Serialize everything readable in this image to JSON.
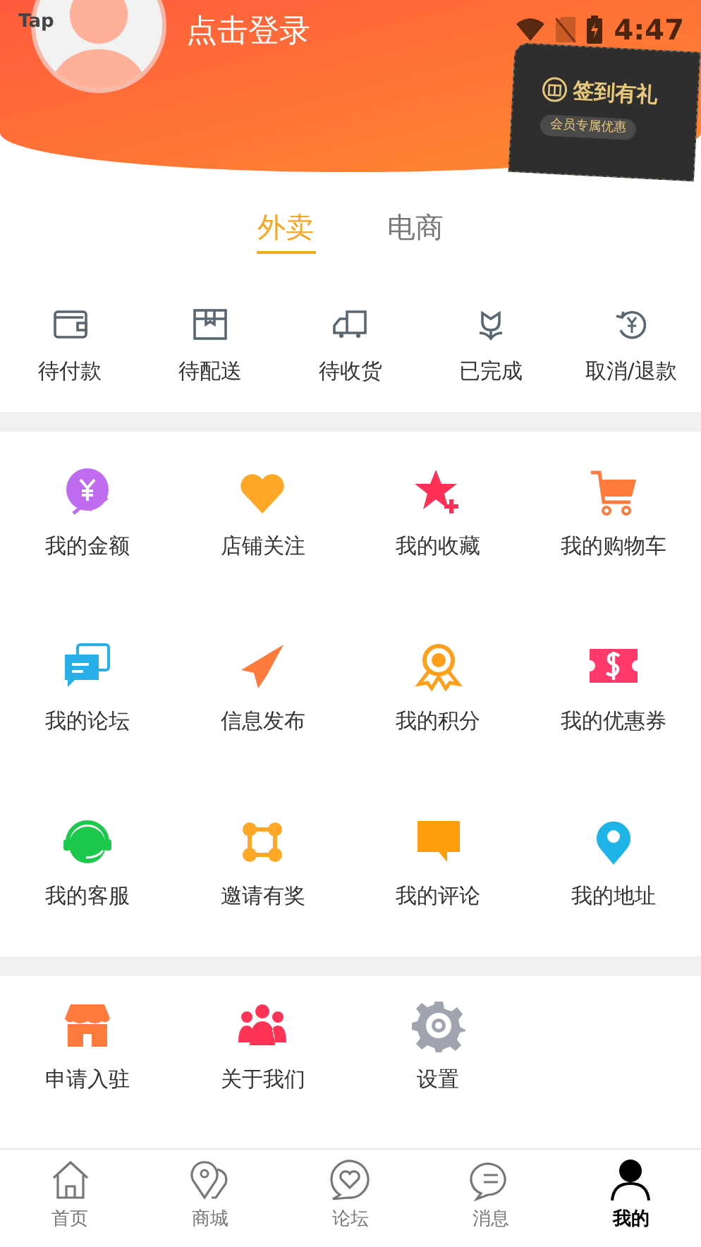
{
  "status_bar": {
    "app_label": "Tap",
    "time": "4:47"
  },
  "profile": {
    "login": "点击登录"
  },
  "checkin_card": {
    "title": "签到有礼",
    "subtitle": "会员专属优惠"
  },
  "tabs": [
    {
      "label": "外卖",
      "selected": true
    },
    {
      "label": "电商",
      "selected": false
    }
  ],
  "orders": [
    {
      "label": "待付款"
    },
    {
      "label": "待配送"
    },
    {
      "label": "待收货"
    },
    {
      "label": "已完成"
    },
    {
      "label": "取消/退款"
    }
  ],
  "features": [
    {
      "label": "我的金额"
    },
    {
      "label": "店铺关注"
    },
    {
      "label": "我的收藏"
    },
    {
      "label": "我的购物车"
    },
    {
      "label": "我的论坛"
    },
    {
      "label": "信息发布"
    },
    {
      "label": "我的积分"
    },
    {
      "label": "我的优惠券"
    },
    {
      "label": "我的客服"
    },
    {
      "label": "邀请有奖"
    },
    {
      "label": "我的评论"
    },
    {
      "label": "我的地址"
    }
  ],
  "more": [
    {
      "label": "申请入驻"
    },
    {
      "label": "关于我们"
    },
    {
      "label": "设置"
    }
  ],
  "bottom_nav": [
    {
      "label": "首页",
      "selected": false
    },
    {
      "label": "商城",
      "selected": false
    },
    {
      "label": "论坛",
      "selected": false
    },
    {
      "label": "消息",
      "selected": false
    },
    {
      "label": "我的",
      "selected": true
    }
  ]
}
